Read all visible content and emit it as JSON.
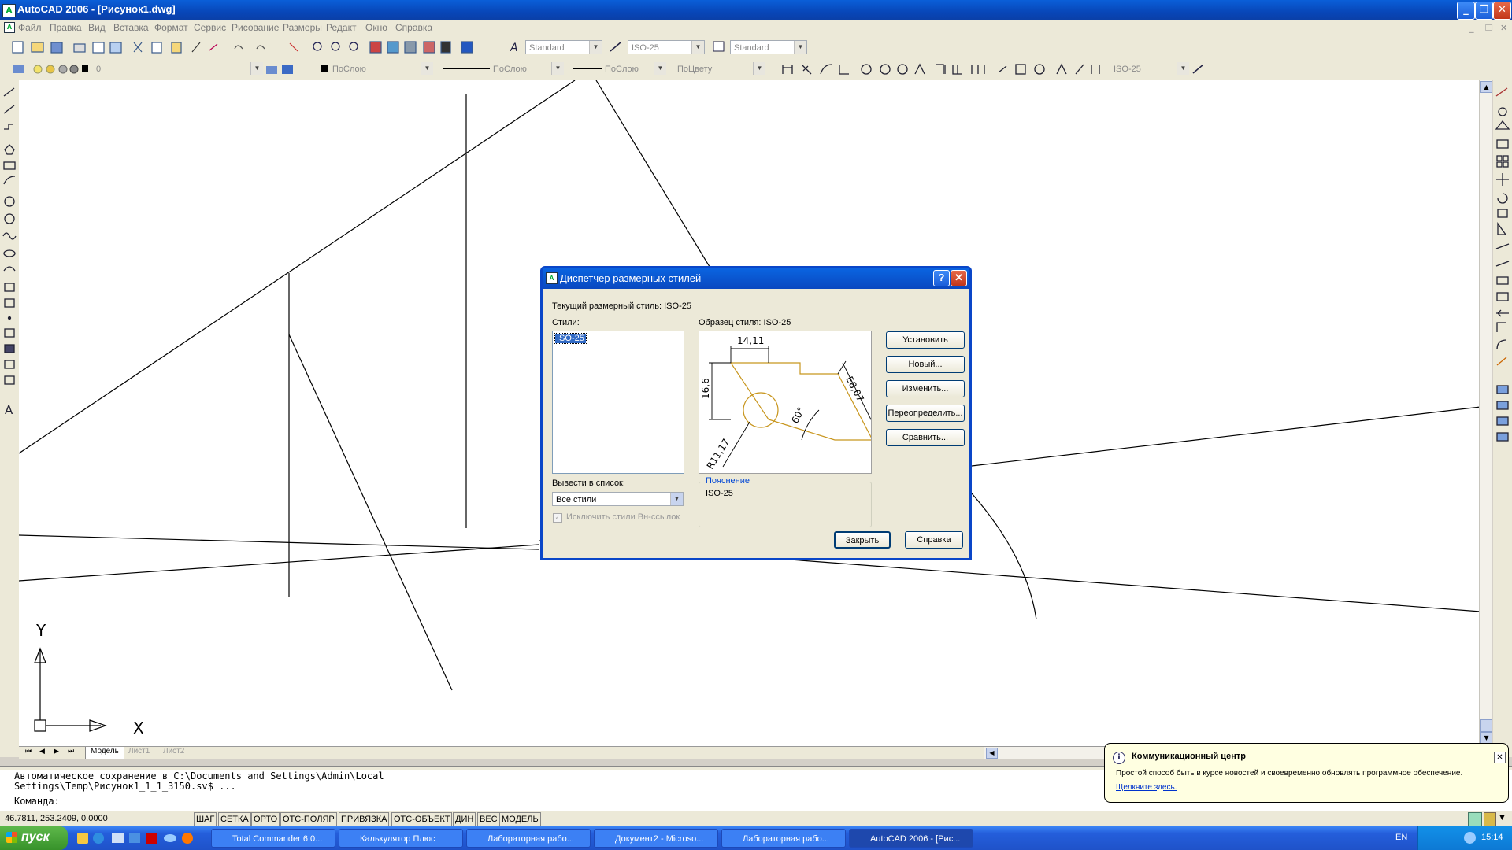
{
  "window": {
    "title": "AutoCAD 2006 - [Рисунок1.dwg]"
  },
  "menu": [
    "Файл",
    "Правка",
    "Вид",
    "Вставка",
    "Формат",
    "Сервис",
    "Рисование",
    "Размеры",
    "Редакт",
    "Окно",
    "Справка"
  ],
  "toolbar": {
    "text_style": "Standard",
    "dim_style": "ISO-25",
    "table_style": "Standard",
    "layer": "0",
    "color": "ПоСлою",
    "linetype": "ПоСлою",
    "lineweight": "ПоСлою",
    "plotstyle": "ПоЦвету",
    "dim_style2": "ISO-25"
  },
  "dialog": {
    "title": "Диспетчер размерных стилей",
    "current_style": "Текущий размерный стиль: ISO-25",
    "styles_label": "Стили:",
    "styles": [
      "ISO-25"
    ],
    "preview_label": "Образец стиля: ISO-25",
    "preview_dims": {
      "top": "14,11",
      "left": "16,6",
      "diag": "E8,07",
      "angle": "60°",
      "radius": "R11,17"
    },
    "buttons": {
      "set": "Установить",
      "new": "Новый...",
      "modify": "Изменить...",
      "override": "Переопределить...",
      "compare": "Сравнить...",
      "close": "Закрыть",
      "help": "Справка"
    },
    "list_label": "Вывести в список:",
    "list_value": "Все стили",
    "exclude_xref": "Исключить стили Вн-ссылок",
    "desc_label": "Пояснение",
    "desc_value": "ISO-25"
  },
  "tabs": [
    "Модель",
    "Лист1",
    "Лист2"
  ],
  "ucs": {
    "x": "X",
    "y": "Y"
  },
  "command": {
    "line1": "Автоматическое сохранение в C:\\Documents and Settings\\Admin\\Local",
    "line2": "Settings\\Temp\\Рисунок1_1_1_3150.sv$ ...",
    "prompt": "Команда:"
  },
  "status": {
    "coords": "46.7811, 253.2409, 0.0000",
    "buttons": [
      "ШАГ",
      "СЕТКА",
      "ОРТО",
      "ОТС-ПОЛЯР",
      "ПРИВЯЗКА",
      "ОТС-ОБЪЕКТ",
      "ДИН",
      "ВЕС",
      "МОДЕЛЬ"
    ]
  },
  "balloon": {
    "title": "Коммуникационный центр",
    "text": "Простой способ быть в курсе новостей и своевременно обновлять программное обеспечение.",
    "link": "Щелкните здесь."
  },
  "taskbar": {
    "start": "пуск",
    "tasks": [
      "Total Commander 6.0...",
      "Калькулятор Плюс",
      "Лабораторная рабо...",
      "Документ2 - Microso...",
      "Лабораторная рабо...",
      "AutoCAD 2006 - [Рис..."
    ],
    "lang": "EN",
    "time": "15:14"
  },
  "colors": {
    "accent": "#0a46c8",
    "preview_part": "#c8961e"
  }
}
